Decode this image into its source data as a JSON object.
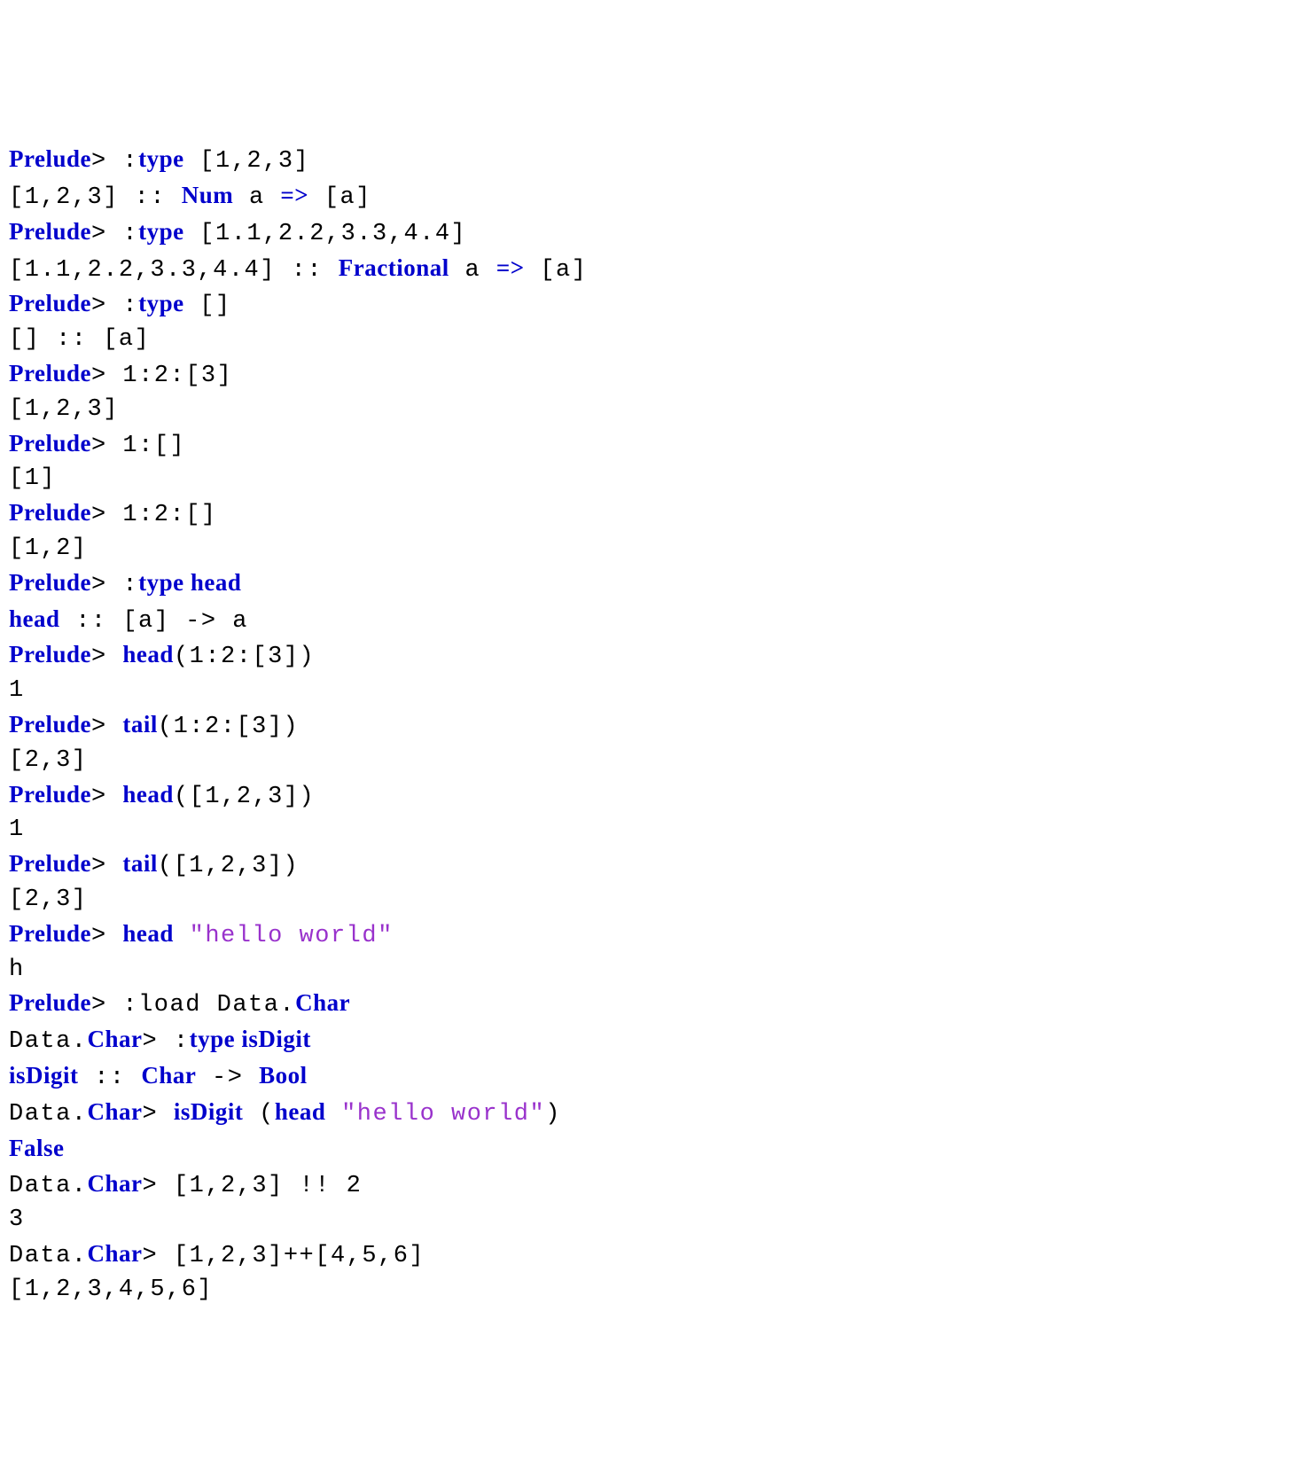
{
  "lines": [
    {
      "segments": [
        {
          "cls": "kw",
          "text": "Prelude"
        },
        {
          "cls": "plain",
          "text": "> :"
        },
        {
          "cls": "kw",
          "text": "type"
        },
        {
          "cls": "plain",
          "text": " [1,2,3]"
        }
      ]
    },
    {
      "segments": [
        {
          "cls": "plain",
          "text": "[1,2,3] :: "
        },
        {
          "cls": "kw",
          "text": "Num"
        },
        {
          "cls": "plain",
          "text": " a "
        },
        {
          "cls": "kw",
          "text": "=>"
        },
        {
          "cls": "plain",
          "text": " [a]"
        }
      ]
    },
    {
      "segments": [
        {
          "cls": "kw",
          "text": "Prelude"
        },
        {
          "cls": "plain",
          "text": "> :"
        },
        {
          "cls": "kw",
          "text": "type"
        },
        {
          "cls": "plain",
          "text": " [1.1,2.2,3.3,4.4]"
        }
      ]
    },
    {
      "segments": [
        {
          "cls": "plain",
          "text": "[1.1,2.2,3.3,4.4] :: "
        },
        {
          "cls": "kw",
          "text": "Fractional"
        },
        {
          "cls": "plain",
          "text": " a "
        },
        {
          "cls": "kw",
          "text": "=>"
        },
        {
          "cls": "plain",
          "text": " [a]"
        }
      ]
    },
    {
      "segments": [
        {
          "cls": "kw",
          "text": "Prelude"
        },
        {
          "cls": "plain",
          "text": "> :"
        },
        {
          "cls": "kw",
          "text": "type"
        },
        {
          "cls": "plain",
          "text": " []"
        }
      ]
    },
    {
      "segments": [
        {
          "cls": "plain",
          "text": "[] :: [a]"
        }
      ]
    },
    {
      "segments": [
        {
          "cls": "kw",
          "text": "Prelude"
        },
        {
          "cls": "plain",
          "text": "> 1:2:[3]"
        }
      ]
    },
    {
      "segments": [
        {
          "cls": "plain",
          "text": "[1,2,3]"
        }
      ]
    },
    {
      "segments": [
        {
          "cls": "kw",
          "text": "Prelude"
        },
        {
          "cls": "plain",
          "text": "> 1:[]"
        }
      ]
    },
    {
      "segments": [
        {
          "cls": "plain",
          "text": "[1]"
        }
      ]
    },
    {
      "segments": [
        {
          "cls": "kw",
          "text": "Prelude"
        },
        {
          "cls": "plain",
          "text": "> 1:2:[]"
        }
      ]
    },
    {
      "segments": [
        {
          "cls": "plain",
          "text": "[1,2]"
        }
      ]
    },
    {
      "segments": [
        {
          "cls": "kw",
          "text": "Prelude"
        },
        {
          "cls": "plain",
          "text": "> :"
        },
        {
          "cls": "kw",
          "text": "type head"
        }
      ]
    },
    {
      "segments": [
        {
          "cls": "kw",
          "text": "head"
        },
        {
          "cls": "plain",
          "text": " :: [a] -> a"
        }
      ]
    },
    {
      "segments": [
        {
          "cls": "kw",
          "text": "Prelude"
        },
        {
          "cls": "plain",
          "text": "> "
        },
        {
          "cls": "kw",
          "text": "head"
        },
        {
          "cls": "plain",
          "text": "(1:2:[3])"
        }
      ]
    },
    {
      "segments": [
        {
          "cls": "plain",
          "text": "1"
        }
      ]
    },
    {
      "segments": [
        {
          "cls": "kw",
          "text": "Prelude"
        },
        {
          "cls": "plain",
          "text": "> "
        },
        {
          "cls": "kw",
          "text": "tail"
        },
        {
          "cls": "plain",
          "text": "(1:2:[3])"
        }
      ]
    },
    {
      "segments": [
        {
          "cls": "plain",
          "text": "[2,3]"
        }
      ]
    },
    {
      "segments": [
        {
          "cls": "kw",
          "text": "Prelude"
        },
        {
          "cls": "plain",
          "text": "> "
        },
        {
          "cls": "kw",
          "text": "head"
        },
        {
          "cls": "plain",
          "text": "([1,2,3])"
        }
      ]
    },
    {
      "segments": [
        {
          "cls": "plain",
          "text": "1"
        }
      ]
    },
    {
      "segments": [
        {
          "cls": "kw",
          "text": "Prelude"
        },
        {
          "cls": "plain",
          "text": "> "
        },
        {
          "cls": "kw",
          "text": "tail"
        },
        {
          "cls": "plain",
          "text": "([1,2,3])"
        }
      ]
    },
    {
      "segments": [
        {
          "cls": "plain",
          "text": "[2,3]"
        }
      ]
    },
    {
      "segments": [
        {
          "cls": "kw",
          "text": "Prelude"
        },
        {
          "cls": "plain",
          "text": "> "
        },
        {
          "cls": "kw",
          "text": "head"
        },
        {
          "cls": "plain",
          "text": " "
        },
        {
          "cls": "str",
          "text": "\"hello world\""
        }
      ]
    },
    {
      "segments": [
        {
          "cls": "plain",
          "text": "h"
        }
      ]
    },
    {
      "segments": [
        {
          "cls": "kw",
          "text": "Prelude"
        },
        {
          "cls": "plain",
          "text": "> :load Data."
        },
        {
          "cls": "kw",
          "text": "Char"
        }
      ]
    },
    {
      "segments": [
        {
          "cls": "plain",
          "text": "Data."
        },
        {
          "cls": "kw",
          "text": "Char"
        },
        {
          "cls": "plain",
          "text": "> :"
        },
        {
          "cls": "kw",
          "text": "type isDigit"
        }
      ]
    },
    {
      "segments": [
        {
          "cls": "kw",
          "text": "isDigit"
        },
        {
          "cls": "plain",
          "text": " :: "
        },
        {
          "cls": "kw",
          "text": "Char"
        },
        {
          "cls": "plain",
          "text": " -> "
        },
        {
          "cls": "kw",
          "text": "Bool"
        }
      ]
    },
    {
      "segments": [
        {
          "cls": "plain",
          "text": "Data."
        },
        {
          "cls": "kw",
          "text": "Char"
        },
        {
          "cls": "plain",
          "text": "> "
        },
        {
          "cls": "kw",
          "text": "isDigit"
        },
        {
          "cls": "plain",
          "text": " ("
        },
        {
          "cls": "kw",
          "text": "head"
        },
        {
          "cls": "plain",
          "text": " "
        },
        {
          "cls": "str",
          "text": "\"hello world\""
        },
        {
          "cls": "plain",
          "text": ")"
        }
      ]
    },
    {
      "segments": [
        {
          "cls": "kw",
          "text": "False"
        }
      ]
    },
    {
      "segments": [
        {
          "cls": "plain",
          "text": "Data."
        },
        {
          "cls": "kw",
          "text": "Char"
        },
        {
          "cls": "plain",
          "text": "> [1,2,3] !! 2"
        }
      ]
    },
    {
      "segments": [
        {
          "cls": "plain",
          "text": "3"
        }
      ]
    },
    {
      "segments": [
        {
          "cls": "plain",
          "text": "Data."
        },
        {
          "cls": "kw",
          "text": "Char"
        },
        {
          "cls": "plain",
          "text": "> [1,2,3]++[4,5,6]"
        }
      ]
    },
    {
      "segments": [
        {
          "cls": "plain",
          "text": "[1,2,3,4,5,6]"
        }
      ]
    }
  ]
}
